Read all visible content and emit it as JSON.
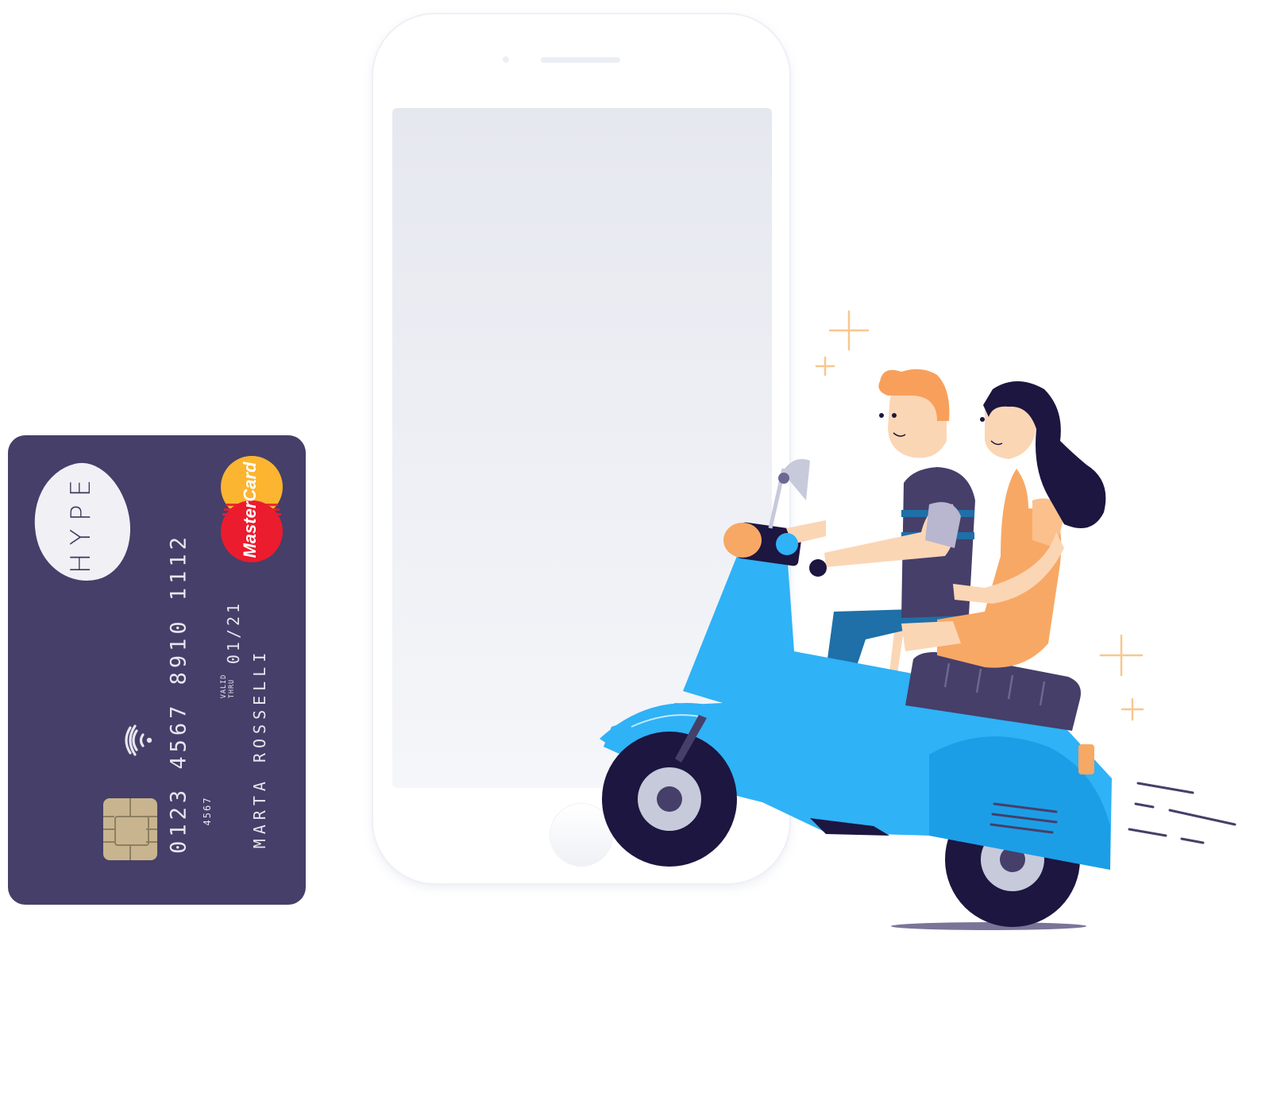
{
  "card": {
    "brand": "HYPE",
    "number": "0123 4567 8910 1112",
    "number_small": "4567",
    "valid_label_1": "VALID",
    "valid_label_2": "THRU",
    "expiry": "01/21",
    "holder": "MARTA ROSSELLI",
    "network": "MasterCard",
    "colors": {
      "card": "#453f69",
      "chip": "#c8b58f",
      "mc_yellow": "#fbb531",
      "mc_red": "#eb1c2d"
    }
  },
  "illustration": {
    "colors": {
      "scooter": "#2fb2f6",
      "seat": "#453f69",
      "wheel": "#1c1640",
      "man_hair": "#f8a05b",
      "woman_dress": "#f8a865",
      "sparkle": "#f8c78e"
    }
  }
}
